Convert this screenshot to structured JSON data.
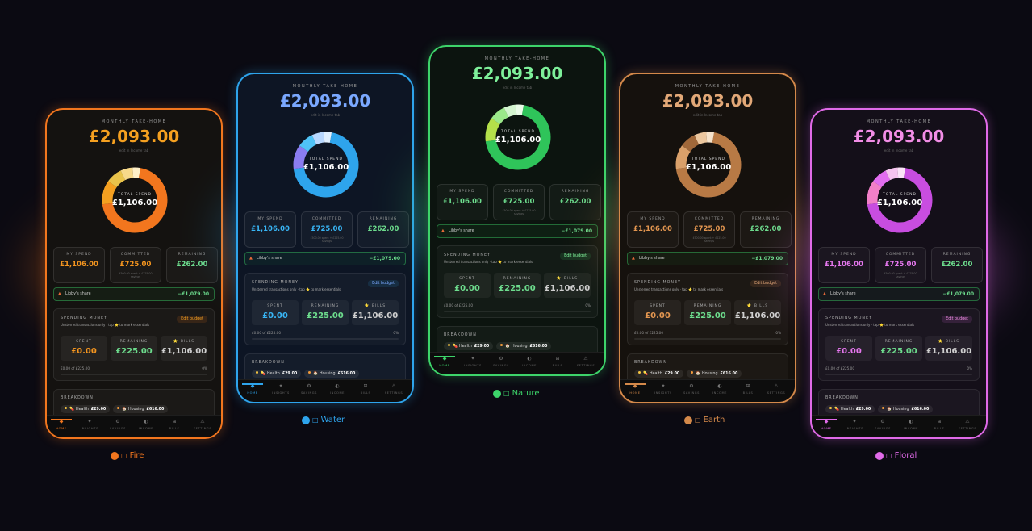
{
  "themes": [
    {
      "key": "fire",
      "caption": "Fire",
      "caption_glyph": "□",
      "accent": "#f2761e",
      "accent2": "#f5a020",
      "bg": "#141210",
      "value_color": "#f4951f",
      "remaining_color": "#6ddc8d",
      "donut_colors": [
        "#f2761e",
        "#f5a020",
        "#e9c34a",
        "#f7d98a",
        "#fff0c8"
      ]
    },
    {
      "key": "water",
      "caption": "Water",
      "caption_glyph": "□",
      "accent": "#2ea4ec",
      "accent2": "#7aa8ff",
      "bg": "#0d1524",
      "value_color": "#38b5f5",
      "remaining_color": "#6ddc8d",
      "donut_colors": [
        "#2ea4ec",
        "#8a7cf0",
        "#4fc3f7",
        "#b8d8ff",
        "#e0f0ff"
      ]
    },
    {
      "key": "nature",
      "caption": "Nature",
      "caption_glyph": "□",
      "accent": "#3dd46a",
      "accent2": "#7ef09a",
      "bg": "#0c140f",
      "value_color": "#6ddc8d",
      "remaining_color": "#6ddc8d",
      "donut_colors": [
        "#2fc45a",
        "#b4e04a",
        "#9be88a",
        "#d4f5d0",
        "#eafbe8"
      ]
    },
    {
      "key": "earth",
      "caption": "Earth",
      "caption_glyph": "□",
      "accent": "#d4894a",
      "accent2": "#e2a877",
      "bg": "#15110d",
      "value_color": "#e39650",
      "remaining_color": "#6ddc8d",
      "donut_colors": [
        "#b87a45",
        "#d9a06a",
        "#a0683a",
        "#ecc79f",
        "#f6e3cc"
      ]
    },
    {
      "key": "floral",
      "caption": "Floral",
      "caption_glyph": "□",
      "accent": "#e06ae8",
      "accent2": "#f28de6",
      "bg": "#140f19",
      "value_color": "#e577ee",
      "remaining_color": "#6ddc8d",
      "donut_colors": [
        "#c84de0",
        "#f27fc8",
        "#e26df0",
        "#f5c3ef",
        "#fbe3f8"
      ]
    }
  ],
  "app": {
    "header_label": "MONTHLY TAKE-HOME",
    "take_home": "£2,093.00",
    "take_home_sub": "edit in Income tab",
    "donut_label": "TOTAL SPEND",
    "donut_value": "£1,106.00",
    "donut_shares": [
      0.7,
      0.12,
      0.08,
      0.06,
      0.04
    ],
    "stats": [
      {
        "title": "MY SPEND",
        "value": "£1,106.00",
        "note": ""
      },
      {
        "title": "COMMITTED",
        "value": "£725.00",
        "note": "£500.00 spent + £225.00 savings"
      },
      {
        "title": "REMAINING",
        "value": "£262.00",
        "note": ""
      }
    ],
    "share_label": "Libby's share",
    "share_value": "−£1,079.00",
    "spending": {
      "title": "SPENDING MONEY",
      "subtitle": "Unsterred transactions only · tap ⭐ to mark essentials",
      "edit_button": "Edit budget",
      "boxes": [
        {
          "title": "SPENT",
          "value": "£0.00"
        },
        {
          "title": "REMAINING",
          "value": "£225.00"
        },
        {
          "title": "⭐ BILLS",
          "value": "£1,106.00"
        }
      ],
      "progress_text": "£0.00 of £225.00",
      "progress_pct": "0%",
      "progress_value": 0
    },
    "breakdown": {
      "title": "BREAKDOWN",
      "pills": [
        {
          "icon": "💊",
          "label": "Health",
          "value": "£29.00",
          "color": "#f5c542"
        },
        {
          "icon": "🏠",
          "label": "Housing",
          "value": "£616.00",
          "color": "#f29a3a"
        }
      ]
    },
    "nav": [
      {
        "label": "HOME",
        "icon": "◆",
        "icon_name": "home-icon",
        "active": true
      },
      {
        "label": "INSIGHTS",
        "icon": "✦",
        "icon_name": "insights-icon",
        "active": false
      },
      {
        "label": "SAVINGS",
        "icon": "⚙",
        "icon_name": "savings-icon",
        "active": false
      },
      {
        "label": "INCOME",
        "icon": "◐",
        "icon_name": "income-icon",
        "active": false
      },
      {
        "label": "BILLS",
        "icon": "⊞",
        "icon_name": "bills-icon",
        "active": false
      },
      {
        "label": "SETTINGS",
        "icon": "⚠",
        "icon_name": "settings-icon",
        "active": false
      }
    ]
  }
}
